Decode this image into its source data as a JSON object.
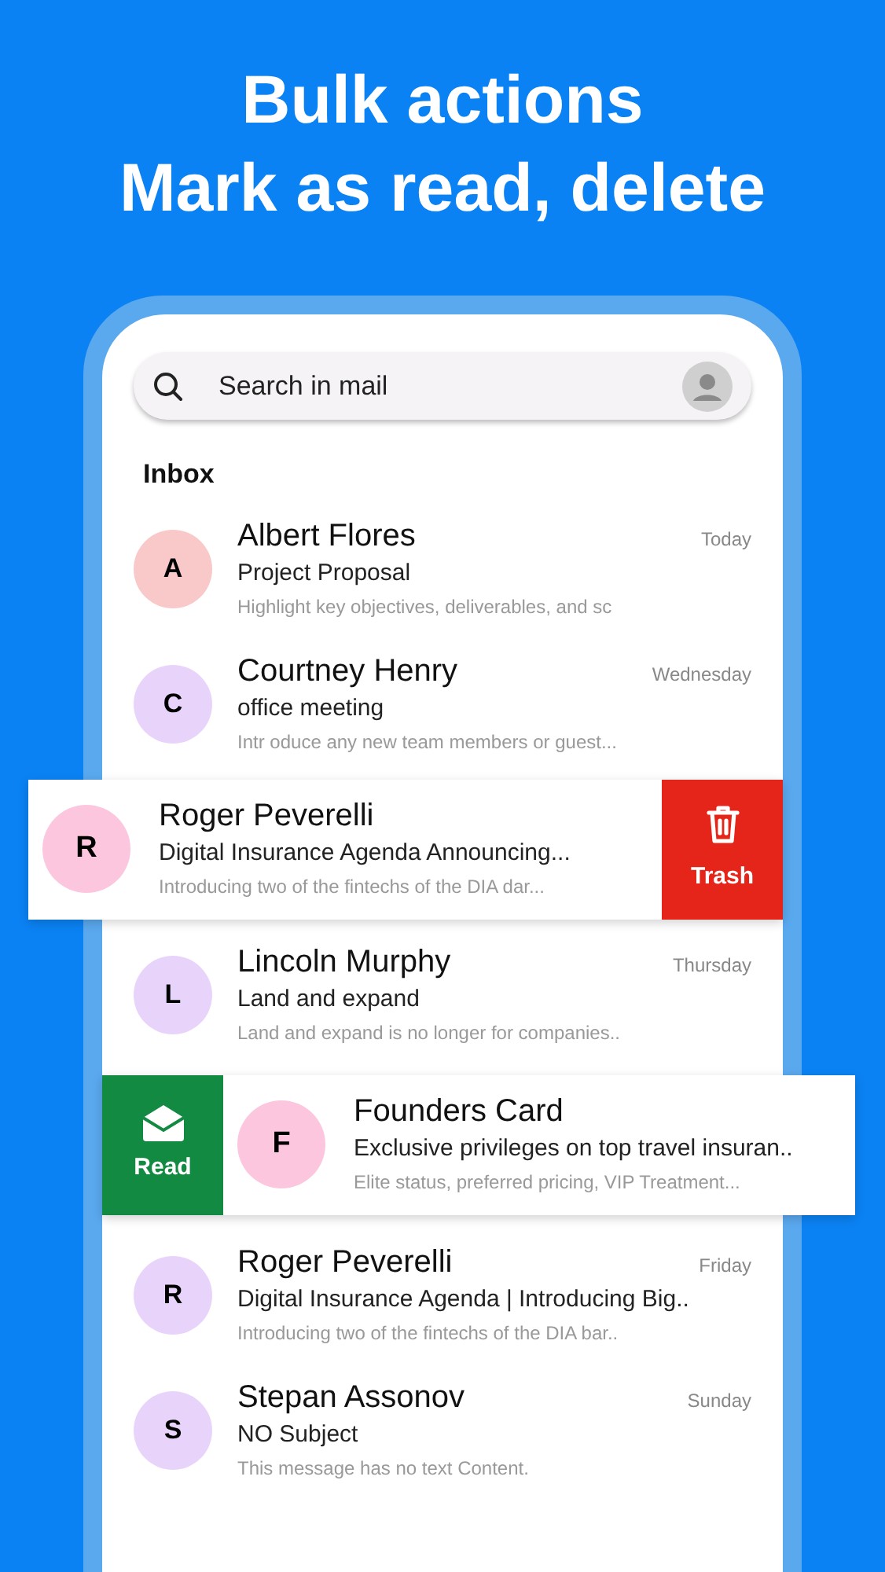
{
  "headline": [
    "Bulk actions",
    "Mark as read, delete"
  ],
  "search": {
    "placeholder": "Search in mail"
  },
  "section_title": "Inbox",
  "emails": [
    {
      "kind": "normal",
      "initial": "A",
      "color": "#f9c9c9",
      "sender": "Albert Flores",
      "subject": "Project Proposal",
      "preview": "Highlight key objectives, deliverables, and sc",
      "date": "Today"
    },
    {
      "kind": "normal",
      "initial": "C",
      "color": "#e8d4fb",
      "sender": "Courtney Henry",
      "subject": "office meeting",
      "preview": "Intr oduce any new team members or guest...",
      "date": "Wednesday"
    },
    {
      "kind": "swiped_left",
      "initial": "R",
      "color": "#fbc6de",
      "sender": "Roger Peverelli",
      "subject": "Digital Insurance Agenda Announcing...",
      "preview": "Introducing two of the fintechs of the DIA dar...",
      "action": "Trash"
    },
    {
      "kind": "normal",
      "initial": "L",
      "color": "#e8d4fb",
      "sender": "Lincoln Murphy",
      "subject": "Land and expand",
      "preview": "Land and expand is no longer for companies..",
      "date": "Thursday"
    },
    {
      "kind": "swiped_right",
      "initial": "F",
      "color": "#fbc6de",
      "sender": "Founders Card",
      "subject": "Exclusive privileges on top travel insuran..",
      "preview": "Elite status, preferred pricing, VIP Treatment...",
      "action": "Read"
    },
    {
      "kind": "normal",
      "initial": "R",
      "color": "#e8d4fb",
      "sender": "Roger Peverelli",
      "subject": "Digital Insurance Agenda | Introducing Big..",
      "preview": "Introducing two of the fintechs of the DIA bar..",
      "date": "Friday"
    },
    {
      "kind": "normal",
      "initial": "S",
      "color": "#e8d4fb",
      "sender": "Stepan Assonov",
      "subject": "NO Subject",
      "preview": "This message has no text Content.",
      "date": "Sunday"
    }
  ]
}
